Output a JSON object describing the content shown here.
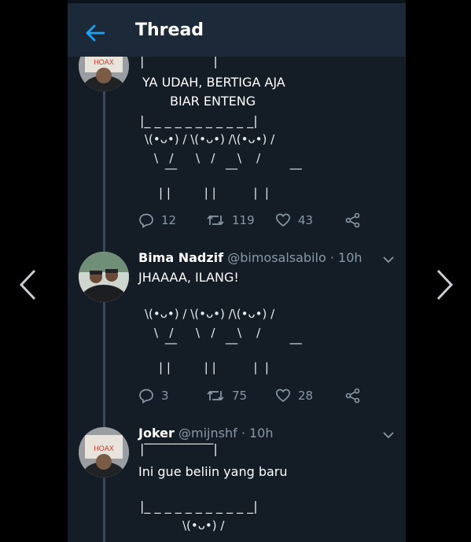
{
  "header": {
    "title": "Thread"
  },
  "tweets": [
    {
      "lines": [
        "YA UDAH, BERTIGA AJA",
        "BIAR ENTENG"
      ],
      "sign_top": "|‾‾‾‾‾‾‾‾‾‾‾|",
      "sign_bottom": "|_ _ _ _ _ _ _ _ _ _ _|",
      "ascii": [
        "\\(•ᴗ•) / \\(•ᴗ•) /\\(•ᴗ•) /",
        "\\   /      \\   /      \\    /",
        "‾‾             ‾‾              ‾‾",
        "| |         | |          |  |"
      ],
      "replies": "12",
      "retweets": "119",
      "likes": "43"
    },
    {
      "name": "Bima Nadzif",
      "handle": "@bimosalsabilo · 10h",
      "lines": [
        "JHAAAA, ILANG!"
      ],
      "ascii": [
        "\\(•ᴗ•) / \\(•ᴗ•) /\\(•ᴗ•) /",
        "\\   /      \\   /      \\    /",
        "‾‾             ‾‾              ‾‾",
        "| |         | |          |  |"
      ],
      "replies": "3",
      "retweets": "75",
      "likes": "28"
    },
    {
      "name": "Joker",
      "handle": "@mijnshf · 10h",
      "sign_top": "|‾‾‾‾‾‾‾‾‾‾‾|",
      "lines": [
        "Ini gue beliin yang baru"
      ],
      "sign_bottom": "|_ _ _ _ _ _ _ _ _ _ _|",
      "ascii": [
        "\\(•ᴗ•) /"
      ]
    }
  ],
  "avatar_text": "HOAX"
}
